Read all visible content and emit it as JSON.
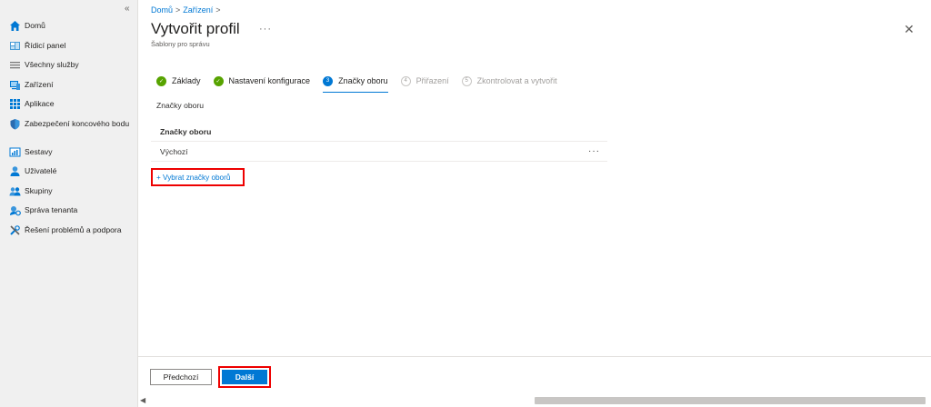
{
  "sidebar": {
    "collapse_icon": "«",
    "items": [
      {
        "label": "Domů",
        "icon": "home-icon"
      },
      {
        "label": "Řídicí panel",
        "icon": "dashboard-icon"
      },
      {
        "label": "Všechny služby",
        "icon": "list-icon"
      },
      {
        "label": "Zařízení",
        "icon": "device-icon"
      },
      {
        "label": "Aplikace",
        "icon": "apps-icon"
      },
      {
        "label": "Zabezpečení koncového bodu",
        "icon": "shield-icon"
      },
      {
        "label": "Sestavy",
        "icon": "reports-icon"
      },
      {
        "label": "Uživatelé",
        "icon": "user-icon"
      },
      {
        "label": "Skupiny",
        "icon": "group-icon"
      },
      {
        "label": "Správa tenanta",
        "icon": "tenant-icon"
      },
      {
        "label": "Řešení problémů a podpora",
        "icon": "troubleshoot-icon"
      }
    ]
  },
  "breadcrumb": {
    "items": [
      "Domů",
      "Zařízení"
    ],
    "separator": ">"
  },
  "header": {
    "title": "Vytvořit profil",
    "more": "···",
    "subtitle": "Šablony pro správu",
    "close": "✕"
  },
  "wizard": {
    "steps": [
      {
        "label": "Základy",
        "state": "done",
        "marker": "✓"
      },
      {
        "label": "Nastavení konfigurace",
        "state": "done",
        "marker": "✓"
      },
      {
        "label": "Značky oboru",
        "state": "current",
        "marker": "3"
      },
      {
        "label": "Přiřazení",
        "state": "pending",
        "marker": "4"
      },
      {
        "label": "Zkontrolovat a vytvořit",
        "state": "pending",
        "marker": "5"
      }
    ]
  },
  "content": {
    "section_label": "Značky oboru",
    "table_header": "Značky oboru",
    "rows": [
      {
        "value": "Výchozí",
        "more": "···"
      }
    ],
    "add_link": "+ Vybrat značky oborů"
  },
  "footer": {
    "prev_label": "Předchozí",
    "next_label": "Další"
  },
  "colors": {
    "accent": "#0078d4",
    "done": "#57a300",
    "highlight": "#ee0000"
  }
}
